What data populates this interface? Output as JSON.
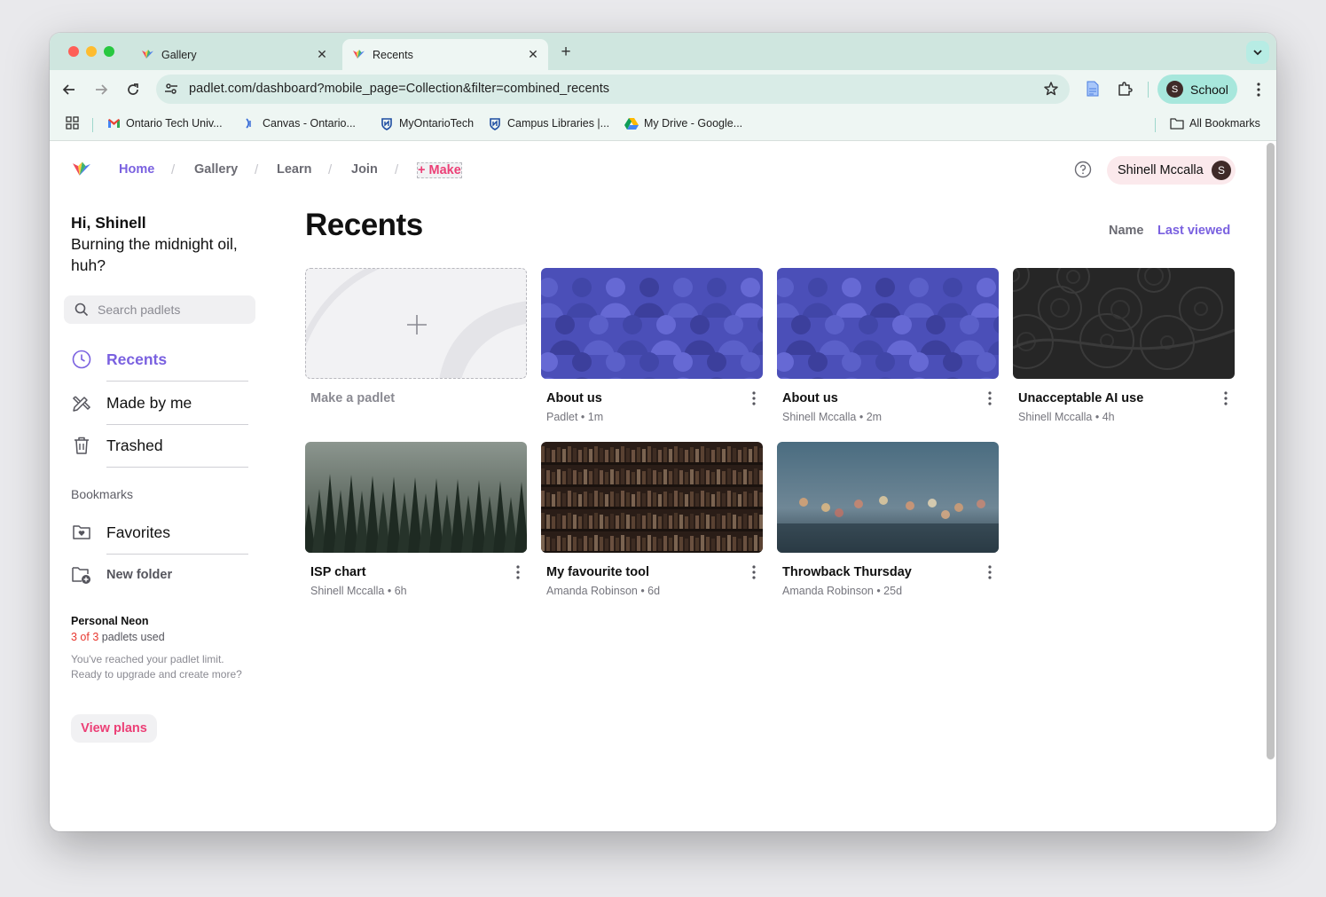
{
  "browser": {
    "tabs": [
      {
        "title": "Gallery",
        "active": false
      },
      {
        "title": "Recents",
        "active": true
      }
    ],
    "url": "padlet.com/dashboard?mobile_page=Collection&filter=combined_recents",
    "profile_label": "School",
    "profile_initial": "S",
    "bookmarks": [
      {
        "label": "Ontario Tech Univ...",
        "icon": "gmail-icon"
      },
      {
        "label": "Canvas - Ontario...",
        "icon": "canvas-icon"
      },
      {
        "label": "MyOntarioTech",
        "icon": "ontariotech-icon"
      },
      {
        "label": "Campus Libraries |...",
        "icon": "ontariotech-icon"
      },
      {
        "label": "My Drive - Google...",
        "icon": "google-drive-icon"
      }
    ],
    "all_bookmarks": "All Bookmarks"
  },
  "topnav": {
    "home": "Home",
    "gallery": "Gallery",
    "learn": "Learn",
    "join": "Join",
    "make": "+ Make",
    "separator": "/",
    "user_name": "Shinell Mccalla",
    "user_initial": "S"
  },
  "sidebar": {
    "greeting_name": "Hi, Shinell",
    "greeting_line": "Burning the midnight oil, huh?",
    "search_placeholder": "Search padlets",
    "items": [
      {
        "label": "Recents",
        "icon": "clock-icon"
      },
      {
        "label": "Made by me",
        "icon": "tools-icon"
      },
      {
        "label": "Trashed",
        "icon": "trash-icon"
      }
    ],
    "bookmarks_heading": "Bookmarks",
    "favorites": "Favorites",
    "new_folder": "New folder",
    "plan_name": "Personal Neon",
    "usage_count": "3 of 3",
    "usage_suffix": " padlets used",
    "limit_message": "You've reached your padlet limit. Ready to upgrade and create more?",
    "view_plans": "View plans"
  },
  "main": {
    "title": "Recents",
    "sort_name": "Name",
    "sort_last_viewed": "Last viewed",
    "make_label": "Make a padlet",
    "cards": [
      {
        "title": "About us",
        "author": "Padlet",
        "age": "1m",
        "thumb": "people"
      },
      {
        "title": "About us",
        "author": "Shinell Mccalla",
        "age": "2m",
        "thumb": "people"
      },
      {
        "title": "Unacceptable AI use",
        "author": "Shinell Mccalla",
        "age": "4h",
        "thumb": "paisley"
      },
      {
        "title": "ISP chart",
        "author": "Shinell Mccalla",
        "age": "6h",
        "thumb": "forest"
      },
      {
        "title": "My favourite tool",
        "author": "Amanda Robinson",
        "age": "6d",
        "thumb": "books"
      },
      {
        "title": "Throwback Thursday",
        "author": "Amanda Robinson",
        "age": "25d",
        "thumb": "city"
      }
    ],
    "meta_separator": " • "
  },
  "colors": {
    "accent": "#7a61e0",
    "make_pink": "#ec3f76",
    "tabbar": "#cfe6df",
    "profile_pill": "#a7e7dc"
  }
}
